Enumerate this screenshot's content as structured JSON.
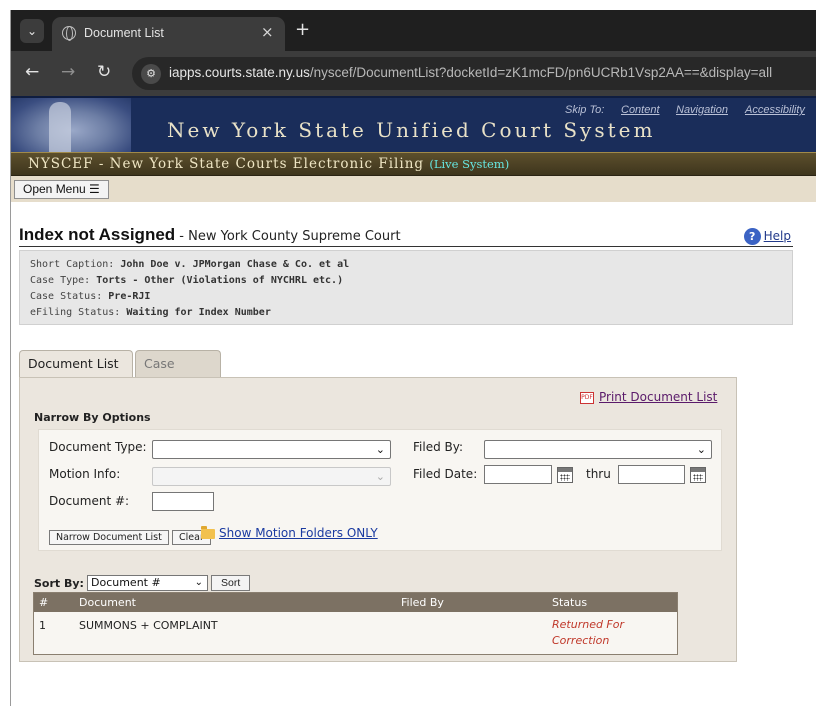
{
  "browser": {
    "tab_title": "Document List",
    "tab_close": "×",
    "new_tab": "+",
    "url_host": "iapps.courts.state.ny.us",
    "url_path": "/nyscef/DocumentList?docketId=zK1mcFD/pn6UCRb1Vsp2AA==&display=all",
    "icons": [
      "tab-search-icon",
      "globe-icon",
      "close-icon",
      "plus-icon",
      "back-icon",
      "forward-icon",
      "reload-icon",
      "site-info-icon"
    ]
  },
  "banner": {
    "skip_to": "Skip To:",
    "skip_links": [
      "Content",
      "Navigation",
      "Accessibility"
    ],
    "title": "New York State Unified Court System",
    "nyscef_label": "NYSCEF - New York State Courts Electronic Filing",
    "live_label": "(Live System)"
  },
  "menu": {
    "open_menu": "Open Menu ☰"
  },
  "page": {
    "heading": "Index not Assigned",
    "separator": " - ",
    "court": "New York County Supreme Court",
    "help": "Help"
  },
  "case_info": [
    {
      "label": "Short Caption:",
      "value": "John Doe v. JPMorgan Chase & Co. et al"
    },
    {
      "label": "Case Type:",
      "value": "Torts - Other (Violations of NYCHRL etc.)"
    },
    {
      "label": "Case Status:",
      "value": "Pre-RJI"
    },
    {
      "label": "eFiling Status:",
      "value": "Waiting for Index Number"
    }
  ],
  "tabs": [
    {
      "label": "Document List",
      "active": true
    },
    {
      "label": "Case Detail",
      "active": false
    }
  ],
  "panel": {
    "print_link": "Print Document List",
    "narrow_title": "Narrow By Options",
    "document_type_label": "Document Type:",
    "document_type_value": "",
    "motion_info_label": "Motion Info:",
    "document_number_label": "Document #:",
    "filed_by_label": "Filed By:",
    "filed_by_value": "",
    "filed_date_label": "Filed Date:",
    "thru_label": "thru",
    "narrow_button": "Narrow Document List",
    "clear_button": "Clear",
    "motion_folders_link": "Show Motion Folders ONLY",
    "sort_by_label": "Sort By:",
    "sort_by_value": "Document #",
    "sort_button": "Sort"
  },
  "table": {
    "columns": [
      "#",
      "Document",
      "Filed By",
      "Status"
    ],
    "rows": [
      {
        "number": "1",
        "document": "SUMMONS + COMPLAINT",
        "filed_by": "",
        "status_line1": "Returned For",
        "status_line2": "Correction"
      }
    ]
  },
  "colors": {
    "banner_navy": "#1a2d5a",
    "nyscef_bar": "#4d4225",
    "menu_strip": "#e6ddcb",
    "panel_bg": "#ebe6de",
    "table_header": "#7c7163",
    "status_red": "#c0392b",
    "link_blue": "#1a3aa0"
  }
}
